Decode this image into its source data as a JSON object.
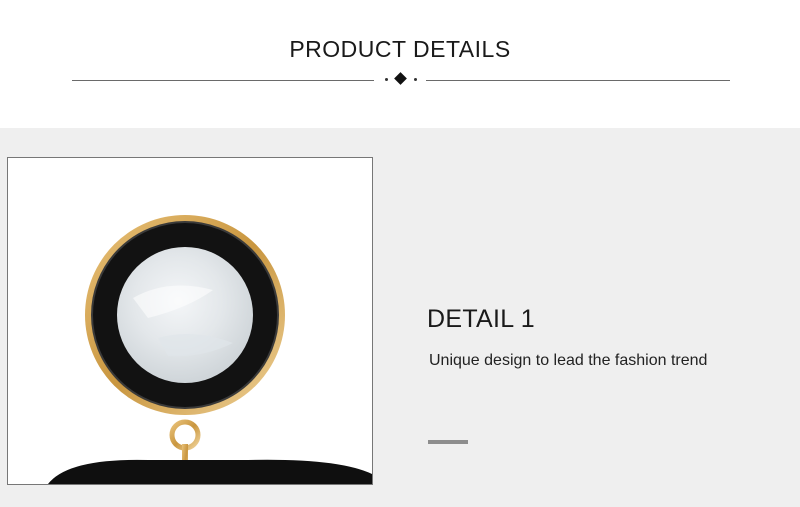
{
  "header": {
    "title": "PRODUCT DETAILS"
  },
  "detail": {
    "title": "DETAIL 1",
    "description": "Unique design to lead the fashion trend"
  },
  "image": {
    "subject": "earring-closeup",
    "colors": {
      "gold": "#d2a24e",
      "black_ring": "#141414",
      "shell": "#e8ecef"
    }
  },
  "colors": {
    "panel_bg": "#efefef",
    "header_bg": "#ffffff",
    "accent_bar": "#8d8d8d"
  }
}
